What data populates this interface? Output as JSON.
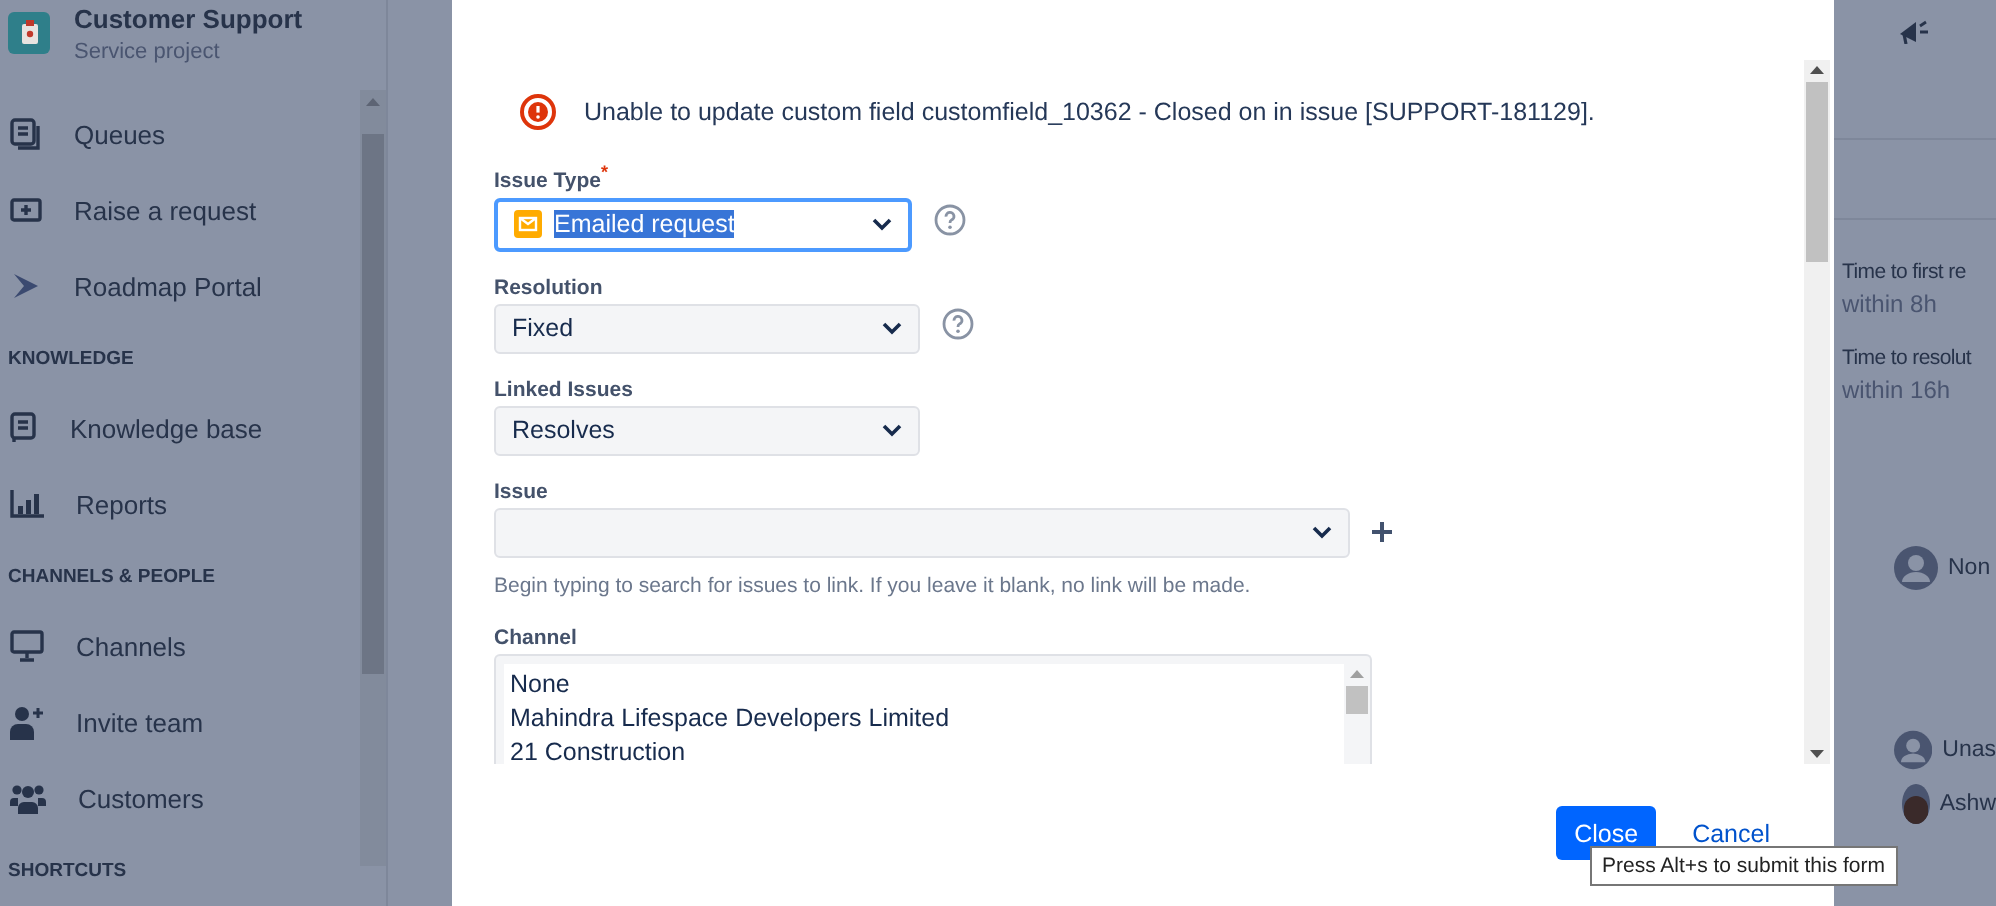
{
  "sidebar": {
    "project": {
      "name": "Customer Support",
      "type": "Service project"
    },
    "sections": [
      {
        "items": [
          "Queues",
          "Raise a request",
          "Roadmap Portal"
        ]
      },
      {
        "heading": "KNOWLEDGE",
        "items": [
          "Knowledge base",
          "Reports"
        ]
      },
      {
        "heading": "CHANNELS & PEOPLE",
        "items": [
          "Channels",
          "Invite team",
          "Customers"
        ]
      },
      {
        "heading": "SHORTCUTS"
      }
    ]
  },
  "dialog": {
    "error": "Unable to update custom field customfield_10362 - Closed on in issue [SUPPORT-181129].",
    "fields": [
      {
        "kind": "select",
        "label": "Issue Type",
        "required": true,
        "value": "Emailed request",
        "highlighted": true,
        "help": true,
        "add": false
      },
      {
        "kind": "select",
        "label": "Resolution",
        "required": false,
        "value": "Fixed",
        "highlighted": false,
        "help": true,
        "add": false
      },
      {
        "kind": "select",
        "label": "Linked Issues",
        "required": false,
        "value": "Resolves",
        "highlighted": false,
        "help": false,
        "add": false
      },
      {
        "kind": "wide-select",
        "label": "Issue",
        "required": false,
        "highlighted": false,
        "help": false,
        "add": true,
        "hint": "Begin typing to search for issues to link. If you leave it blank, no link will be made."
      },
      {
        "kind": "listbox",
        "label": "Channel",
        "required": false,
        "options": [
          "None",
          "Mahindra Lifespace Developers Limited",
          "21 Construction"
        ]
      }
    ],
    "required_mark": "*",
    "buttons": {
      "submit": "Close",
      "cancel": "Cancel"
    },
    "tooltip": "Press Alt+s to submit this form"
  },
  "side_panel": {
    "sla": [
      {
        "name": "Time to first re",
        "target": "within 8h"
      },
      {
        "name": "Time to resolut",
        "target": "within 16h"
      }
    ],
    "people": [
      {
        "name": "Non",
        "kind": "placeholder"
      },
      {
        "name": "Unas",
        "kind": "placeholder"
      },
      {
        "name": "Ashw"
      }
    ]
  }
}
